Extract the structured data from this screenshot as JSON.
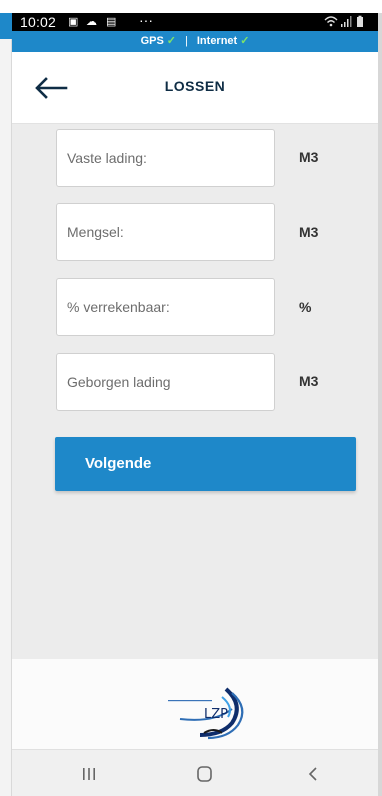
{
  "status": {
    "time": "10:02",
    "more": "···"
  },
  "connection": {
    "gps_label": "GPS",
    "internet_label": "Internet",
    "check": "✓",
    "separator": "|"
  },
  "header": {
    "title": "LOSSEN"
  },
  "fields": [
    {
      "placeholder": "Vaste lading:",
      "value": "",
      "unit": "M3"
    },
    {
      "placeholder": "Mengsel:",
      "value": "",
      "unit": "M3"
    },
    {
      "placeholder": "% verrekenbaar:",
      "value": "",
      "unit": "%"
    },
    {
      "placeholder": "Geborgen lading",
      "value": "",
      "unit": "M3"
    }
  ],
  "next_button": {
    "label": "Volgende"
  },
  "logo": {
    "text": "LZP"
  },
  "colors": {
    "accent": "#1e88c9",
    "ok": "#7ee36a",
    "title": "#0f2d45"
  },
  "icons": {
    "back": "arrow-left-icon",
    "recents": "recents-icon",
    "home": "home-icon",
    "back_nav": "chevron-left-icon"
  }
}
